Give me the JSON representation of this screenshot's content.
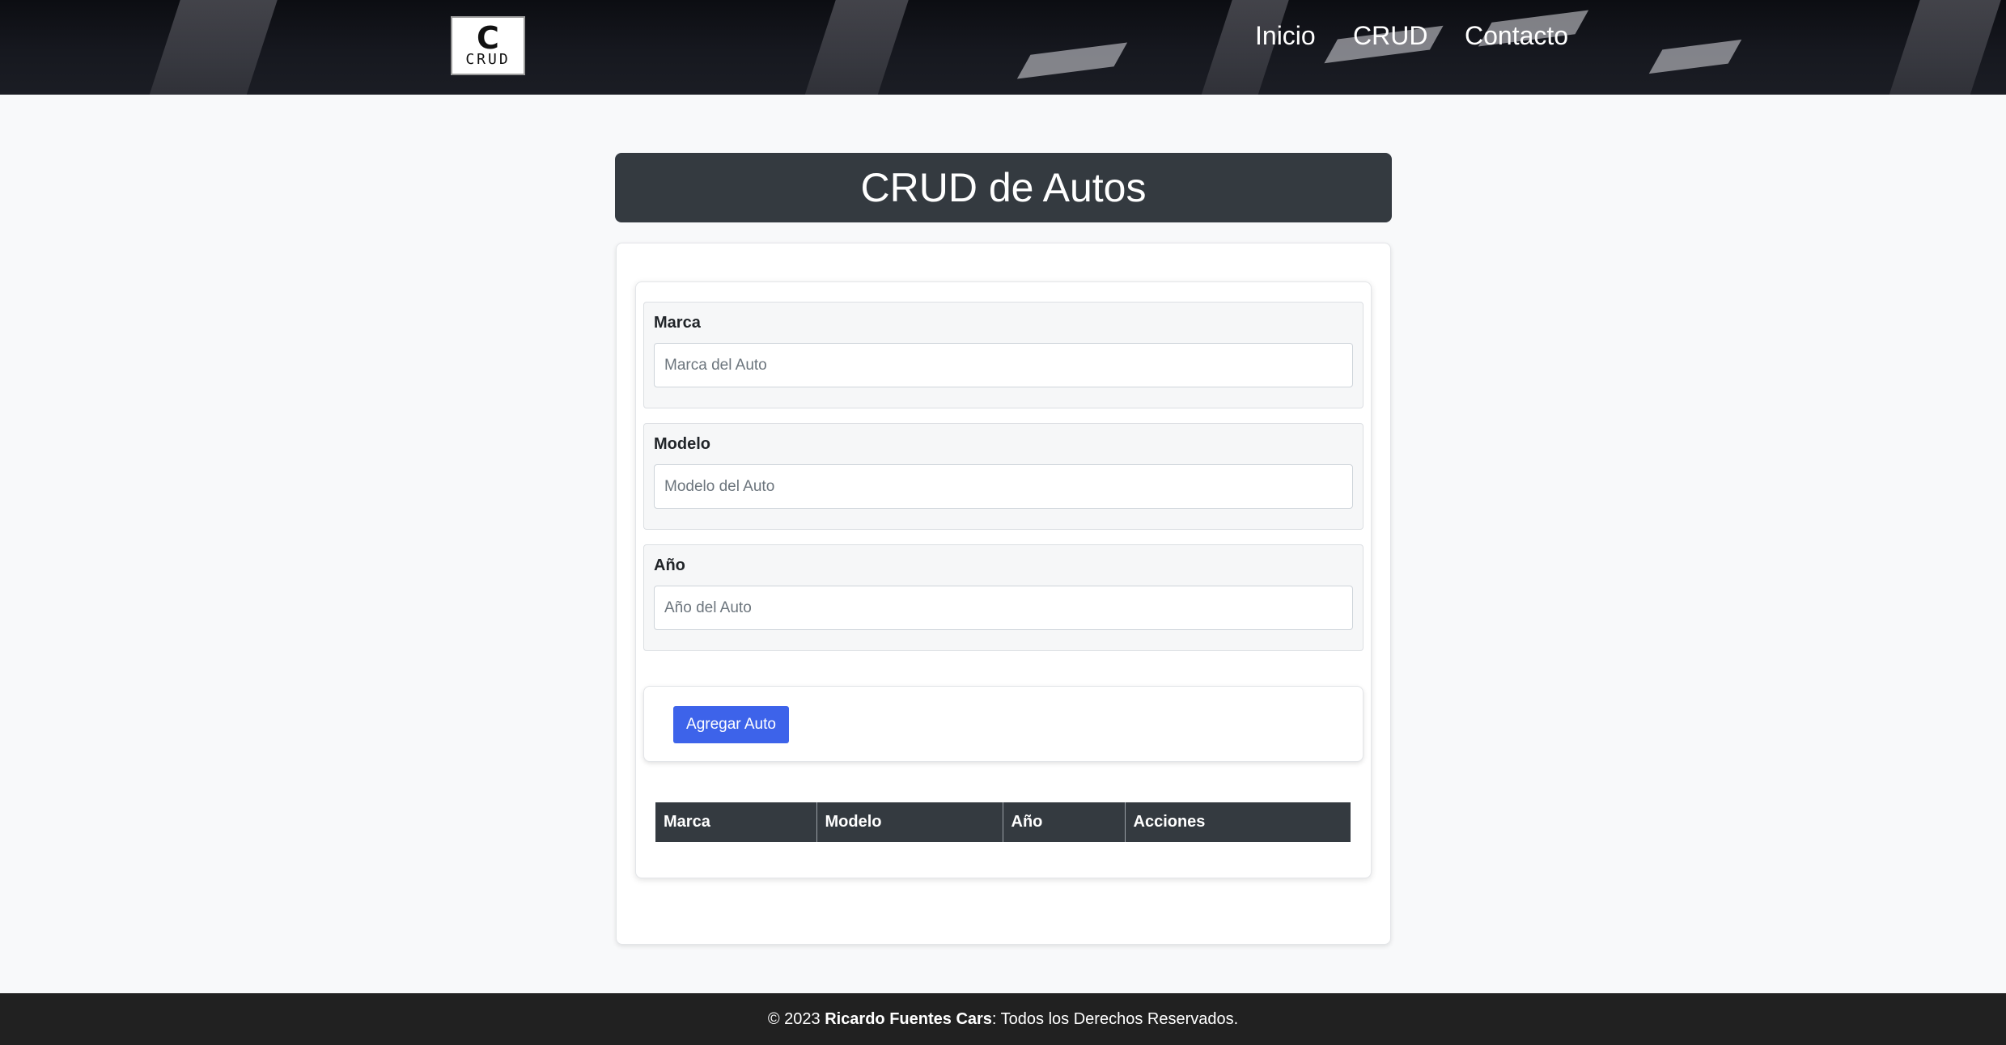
{
  "header": {
    "logo_glyph": "C",
    "logo_text": "CRUD",
    "nav": [
      "Inicio",
      "CRUD",
      "Contacto"
    ]
  },
  "page_title": "CRUD de Autos",
  "form": {
    "fields": [
      {
        "label": "Marca",
        "placeholder": "Marca del Auto",
        "value": ""
      },
      {
        "label": "Modelo",
        "placeholder": "Modelo del Auto",
        "value": ""
      },
      {
        "label": "Año",
        "placeholder": "Año del Auto",
        "value": ""
      }
    ],
    "submit_label": "Agregar Auto"
  },
  "table": {
    "headers": [
      "Marca",
      "Modelo",
      "Año",
      "Acciones"
    ],
    "rows": []
  },
  "footer": {
    "prefix": "© 2023 ",
    "owner": "Ricardo Fuentes Cars",
    "suffix": ": Todos los Derechos Reservados."
  },
  "colors": {
    "header_bg": "#16181f",
    "title_bar": "#343a40",
    "button": "#3d63ea",
    "footer_bg": "#212121",
    "page_bg": "#f8f9fa"
  }
}
